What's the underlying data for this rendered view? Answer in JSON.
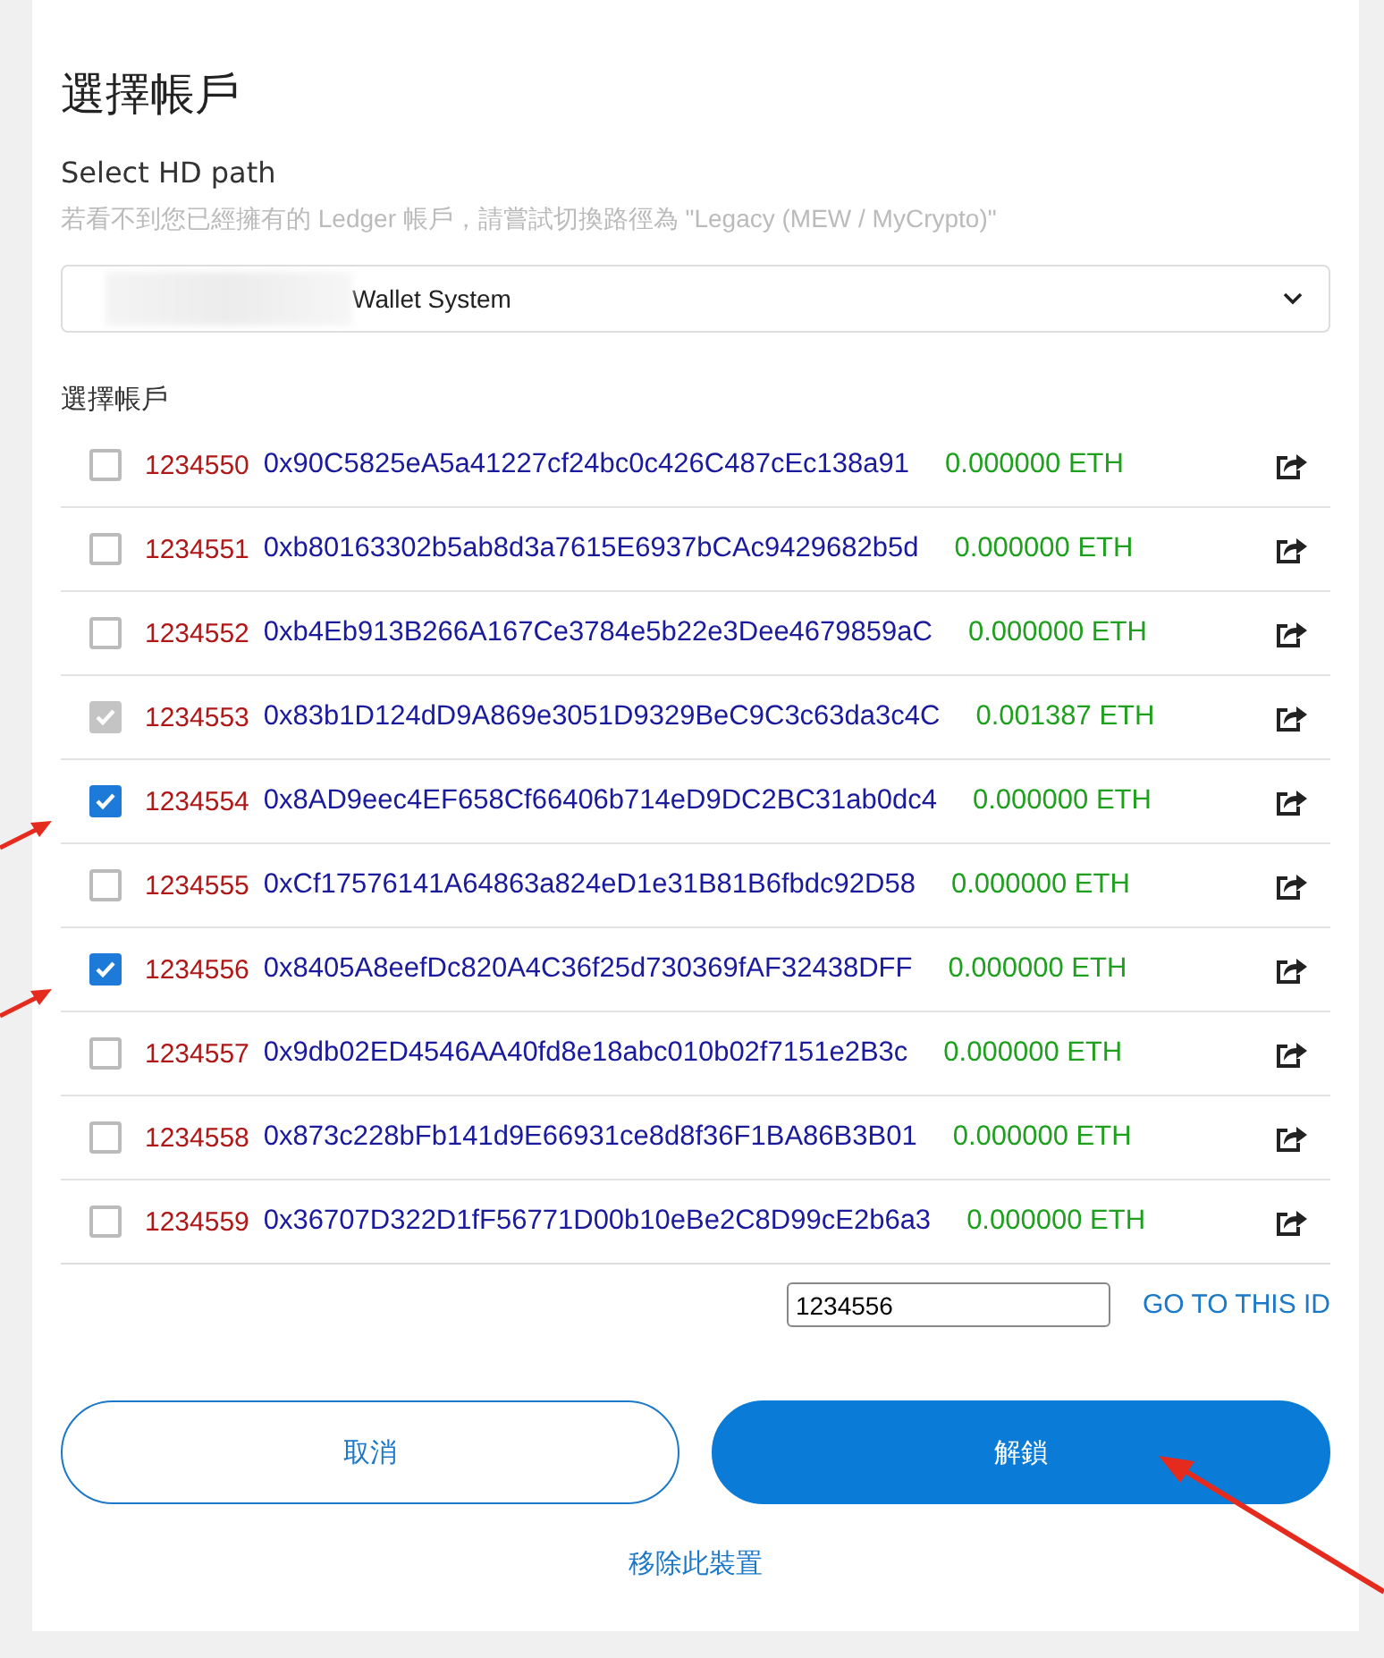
{
  "title": "選擇帳戶",
  "hd_path": {
    "label": "Select HD path",
    "hint": "若看不到您已經擁有的 Ledger 帳戶，請嘗試切換路徑為 \"Legacy (MEW / MyCrypto)\"",
    "value": "Wallet System"
  },
  "accounts_label": "選擇帳戶",
  "accounts": [
    {
      "id": "1234550",
      "address": "0x90C5825eA5a41227cf24bc0c426C487cEc138a91",
      "balance": "0.000000 ETH",
      "checked": false,
      "disabled": false
    },
    {
      "id": "1234551",
      "address": "0xb80163302b5ab8d3a7615E6937bCAc9429682b5d",
      "balance": "0.000000 ETH",
      "checked": false,
      "disabled": false
    },
    {
      "id": "1234552",
      "address": "0xb4Eb913B266A167Ce3784e5b22e3Dee4679859aC",
      "balance": "0.000000 ETH",
      "checked": false,
      "disabled": false
    },
    {
      "id": "1234553",
      "address": "0x83b1D124dD9A869e3051D9329BeC9C3c63da3c4C",
      "balance": "0.001387 ETH",
      "checked": true,
      "disabled": true
    },
    {
      "id": "1234554",
      "address": "0x8AD9eec4EF658Cf66406b714eD9DC2BC31ab0dc4",
      "balance": "0.000000 ETH",
      "checked": true,
      "disabled": false
    },
    {
      "id": "1234555",
      "address": "0xCf17576141A64863a824eD1e31B81B6fbdc92D58",
      "balance": "0.000000 ETH",
      "checked": false,
      "disabled": false
    },
    {
      "id": "1234556",
      "address": "0x8405A8eefDc820A4C36f25d730369fAF32438DFF",
      "balance": "0.000000 ETH",
      "checked": true,
      "disabled": false
    },
    {
      "id": "1234557",
      "address": "0x9db02ED4546AA40fd8e18abc010b02f7151e2B3c",
      "balance": "0.000000 ETH",
      "checked": false,
      "disabled": false
    },
    {
      "id": "1234558",
      "address": "0x873c228bFb141d9E66931ce8d8f36F1BA86B3B01",
      "balance": "0.000000 ETH",
      "checked": false,
      "disabled": false
    },
    {
      "id": "1234559",
      "address": "0x36707D322D1fF56771D00b10eBe2C8D99cE2b6a3",
      "balance": "0.000000 ETH",
      "checked": false,
      "disabled": false
    }
  ],
  "goto": {
    "value": "1234556",
    "link": "GO TO THIS ID"
  },
  "buttons": {
    "cancel": "取消",
    "unlock": "解鎖"
  },
  "remove_link": "移除此裝置"
}
